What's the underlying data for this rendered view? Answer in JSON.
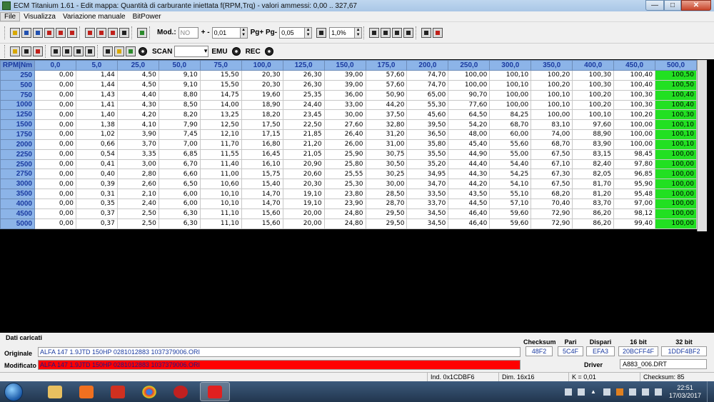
{
  "window": {
    "title": "ECM Titanium 1.61 - Edit mappa: Quantità di carburante iniettata f(RPM,Trq) - valori ammessi: 0,00 .. 327,67",
    "min": "—",
    "max": "□",
    "close": "✕"
  },
  "menu": [
    "File",
    "Visualizza",
    "Variazione manuale",
    "BitPower"
  ],
  "toolbar": {
    "mod_label": "Mod.:",
    "mod_value": "NO",
    "pm_label": "+ -",
    "pm_value": "0,01",
    "pg_label": "Pg+ Pg-",
    "pg_value": "0,05",
    "pct_value": "1,0%",
    "scan_label": "SCAN",
    "emu_label": "EMU",
    "rec_label": "REC"
  },
  "table": {
    "corner": "RPM|Nm",
    "columns": [
      "0,0",
      "5,0",
      "25,0",
      "50,0",
      "75,0",
      "100,0",
      "125,0",
      "150,0",
      "175,0",
      "200,0",
      "250,0",
      "300,0",
      "350,0",
      "400,0",
      "450,0",
      "500,0"
    ],
    "rows": [
      {
        "rpm": "250",
        "v": [
          "0,00",
          "1,44",
          "4,50",
          "9,10",
          "15,50",
          "20,30",
          "26,30",
          "39,00",
          "57,60",
          "74,70",
          "100,00",
          "100,10",
          "100,20",
          "100,30",
          "100,40",
          "100,50"
        ]
      },
      {
        "rpm": "500",
        "v": [
          "0,00",
          "1,44",
          "4,50",
          "9,10",
          "15,50",
          "20,30",
          "26,30",
          "39,00",
          "57,60",
          "74,70",
          "100,00",
          "100,10",
          "100,20",
          "100,30",
          "100,40",
          "100,50"
        ]
      },
      {
        "rpm": "750",
        "v": [
          "0,00",
          "1,43",
          "4,40",
          "8,80",
          "14,75",
          "19,60",
          "25,35",
          "36,00",
          "50,90",
          "65,00",
          "90,70",
          "100,00",
          "100,10",
          "100,20",
          "100,30",
          "100,40"
        ]
      },
      {
        "rpm": "1000",
        "v": [
          "0,00",
          "1,41",
          "4,30",
          "8,50",
          "14,00",
          "18,90",
          "24,40",
          "33,00",
          "44,20",
          "55,30",
          "77,60",
          "100,00",
          "100,10",
          "100,20",
          "100,30",
          "100,40"
        ]
      },
      {
        "rpm": "1250",
        "v": [
          "0,00",
          "1,40",
          "4,20",
          "8,20",
          "13,25",
          "18,20",
          "23,45",
          "30,00",
          "37,50",
          "45,60",
          "64,50",
          "84,25",
          "100,00",
          "100,10",
          "100,20",
          "100,30"
        ]
      },
      {
        "rpm": "1500",
        "v": [
          "0,00",
          "1,38",
          "4,10",
          "7,90",
          "12,50",
          "17,50",
          "22,50",
          "27,60",
          "32,80",
          "39,50",
          "54,20",
          "68,70",
          "83,10",
          "97,60",
          "100,00",
          "100,10"
        ]
      },
      {
        "rpm": "1750",
        "v": [
          "0,00",
          "1,02",
          "3,90",
          "7,45",
          "12,10",
          "17,15",
          "21,85",
          "26,40",
          "31,20",
          "36,50",
          "48,00",
          "60,00",
          "74,00",
          "88,90",
          "100,00",
          "100,10"
        ]
      },
      {
        "rpm": "2000",
        "v": [
          "0,00",
          "0,66",
          "3,70",
          "7,00",
          "11,70",
          "16,80",
          "21,20",
          "26,00",
          "31,00",
          "35,80",
          "45,40",
          "55,60",
          "68,70",
          "83,90",
          "100,00",
          "100,10"
        ]
      },
      {
        "rpm": "2250",
        "v": [
          "0,00",
          "0,54",
          "3,35",
          "6,85",
          "11,55",
          "16,45",
          "21,05",
          "25,90",
          "30,75",
          "35,50",
          "44,90",
          "55,00",
          "67,50",
          "83,15",
          "98,45",
          "100,00"
        ]
      },
      {
        "rpm": "2500",
        "v": [
          "0,00",
          "0,41",
          "3,00",
          "6,70",
          "11,40",
          "16,10",
          "20,90",
          "25,80",
          "30,50",
          "35,20",
          "44,40",
          "54,40",
          "67,10",
          "82,40",
          "97,80",
          "100,00"
        ]
      },
      {
        "rpm": "2750",
        "v": [
          "0,00",
          "0,40",
          "2,80",
          "6,60",
          "11,00",
          "15,75",
          "20,60",
          "25,55",
          "30,25",
          "34,95",
          "44,30",
          "54,25",
          "67,30",
          "82,05",
          "96,85",
          "100,00"
        ]
      },
      {
        "rpm": "3000",
        "v": [
          "0,00",
          "0,39",
          "2,60",
          "6,50",
          "10,60",
          "15,40",
          "20,30",
          "25,30",
          "30,00",
          "34,70",
          "44,20",
          "54,10",
          "67,50",
          "81,70",
          "95,90",
          "100,00"
        ]
      },
      {
        "rpm": "3500",
        "v": [
          "0,00",
          "0,31",
          "2,10",
          "6,00",
          "10,10",
          "14,70",
          "19,10",
          "23,80",
          "28,50",
          "33,50",
          "43,50",
          "55,10",
          "68,20",
          "81,20",
          "95,48",
          "100,00"
        ]
      },
      {
        "rpm": "4000",
        "v": [
          "0,00",
          "0,35",
          "2,40",
          "6,00",
          "10,10",
          "14,70",
          "19,10",
          "23,90",
          "28,70",
          "33,70",
          "44,50",
          "57,10",
          "70,40",
          "83,70",
          "97,00",
          "100,00"
        ]
      },
      {
        "rpm": "4500",
        "v": [
          "0,00",
          "0,37",
          "2,50",
          "6,30",
          "11,10",
          "15,60",
          "20,00",
          "24,80",
          "29,50",
          "34,50",
          "46,40",
          "59,60",
          "72,90",
          "86,20",
          "98,12",
          "100,00"
        ]
      },
      {
        "rpm": "5000",
        "v": [
          "0,00",
          "0,37",
          "2,50",
          "6,30",
          "11,10",
          "15,60",
          "20,00",
          "24,80",
          "29,50",
          "34,50",
          "46,40",
          "59,60",
          "72,90",
          "86,20",
          "99,40",
          "100,00"
        ]
      }
    ]
  },
  "panel": {
    "title": "Dati caricati",
    "original_label": "Originale",
    "original_file": "ALFA 147 1.9JTD 150HP 0281012883 1037379006.ORI",
    "modified_label": "Modificato",
    "modified_file": "ALFA 147 1.9JTD 150HP 0281012883 1037379006.ORI",
    "headers": {
      "checksum": "Checksum",
      "pari": "Pari",
      "dispari": "Dispari",
      "bit16": "16 bit",
      "bit32": "32 bit"
    },
    "values": {
      "checksum": "48F2",
      "pari": "5C4F",
      "dispari": "EFA3",
      "bit16": "20BCFF4F",
      "bit32": "1DDF4BF2"
    },
    "driver_label": "Driver",
    "driver_value": "A883_006.DRT"
  },
  "status": {
    "ind": "Ind. 0x1CDBF6",
    "dim": "Dim. 16x16",
    "k": "K = 0,01",
    "checksum": "Checksum: 85"
  },
  "taskbar": {
    "time": "22:51",
    "date": "17/03/2017"
  }
}
